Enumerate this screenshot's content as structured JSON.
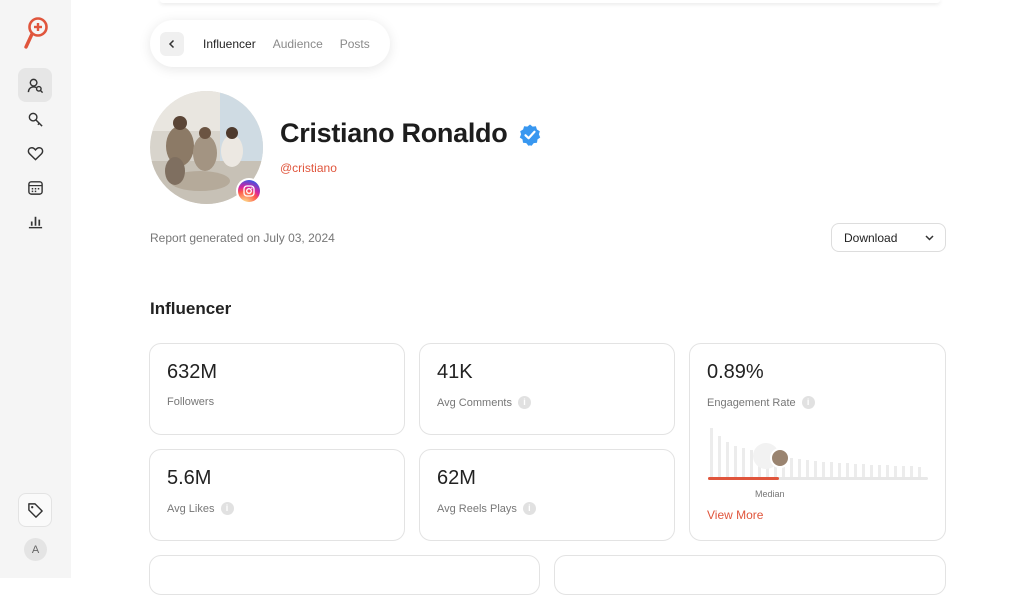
{
  "sidebar": {
    "items": [
      {
        "icon": "user-search-icon"
      },
      {
        "icon": "key-search-icon"
      },
      {
        "icon": "heart-icon"
      },
      {
        "icon": "calendar-icon"
      },
      {
        "icon": "bar-chart-icon"
      }
    ],
    "bottom_icon": "tag-icon",
    "avatar_letter": "A"
  },
  "tabs": {
    "items": [
      "Influencer",
      "Audience",
      "Posts"
    ],
    "active": "Influencer"
  },
  "profile": {
    "name": "Cristiano Ronaldo",
    "handle": "@cristiano",
    "platform": "instagram"
  },
  "report": {
    "generated": "Report generated on July 03, 2024",
    "download_label": "Download"
  },
  "section": {
    "title": "Influencer"
  },
  "stats": {
    "followers": {
      "value": "632M",
      "label": "Followers"
    },
    "avg_comments": {
      "value": "41K",
      "label": "Avg Comments"
    },
    "engagement": {
      "value": "0.89%",
      "label": "Engagement Rate",
      "median_label": "Median",
      "view_more": "View More"
    },
    "avg_likes": {
      "value": "5.6M",
      "label": "Avg Likes"
    },
    "avg_reels": {
      "value": "62M",
      "label": "Avg Reels Plays"
    }
  },
  "colors": {
    "accent": "#e0553c",
    "verified": "#3897f0"
  }
}
